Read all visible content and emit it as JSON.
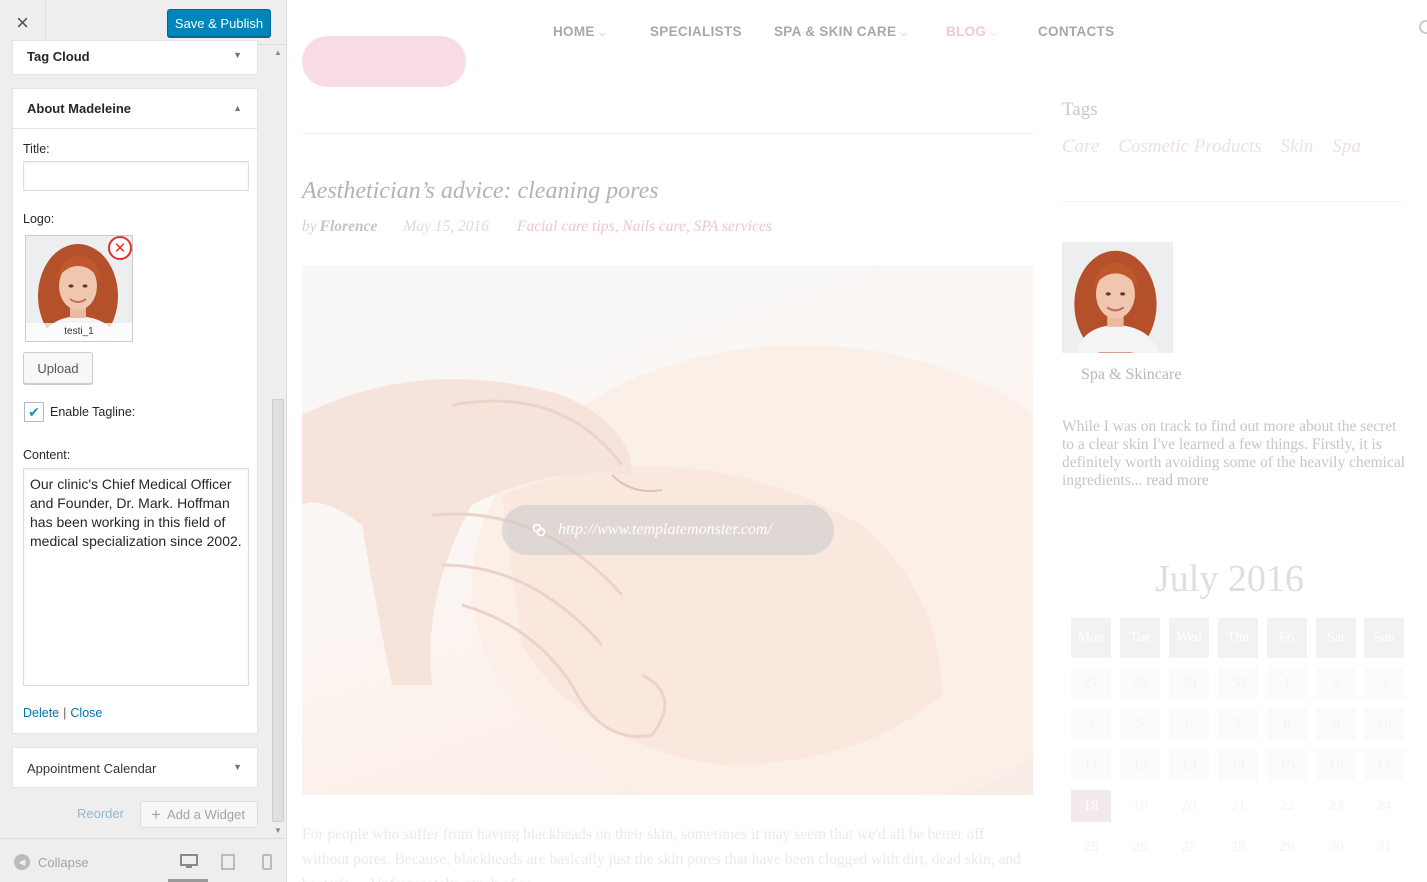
{
  "sidebar": {
    "close_label": "×",
    "publish_label": "Save & Publish",
    "tag_cloud_title": "Tag Cloud",
    "about_title": "About Madeleine",
    "title_label": "Title:",
    "title_value": "",
    "logo_label": "Logo:",
    "logo_caption": "testi_1",
    "upload_label": "Upload",
    "tagline_checked": true,
    "tagline_label": "Enable Tagline:",
    "content_label": "Content:",
    "content_value": "Our clinic's Chief Medical Officer and Founder, Dr. Mark. Hoffman has been working in this field of medical specialization since 2002.",
    "delete_label": "Delete",
    "close_link_label": "Close",
    "appointment_title": "Appointment Calendar",
    "reorder_label": "Reorder",
    "add_widget_label": "Add a Widget",
    "collapse_label": "Collapse",
    "icons": [
      "close-icon",
      "chevron-down-icon",
      "chevron-up-icon",
      "remove-icon",
      "checkmark-icon",
      "plus-icon",
      "collapse-arrow-icon",
      "desktop-icon",
      "tablet-icon",
      "mobile-icon"
    ]
  },
  "preview": {
    "nav": {
      "home": "HOME",
      "specialists": "SPECIALISTS",
      "spa": "SPA & SKIN CARE",
      "blog": "BLOG",
      "contacts": "CONTACTS"
    },
    "post": {
      "title": "Aesthetician’s advice: cleaning pores",
      "by": "by",
      "author": "Florence",
      "date": "May 15, 2016",
      "categories": "Facial care tips, Nails care, SPA services",
      "link_url": "http://www.templatemonster.com/",
      "excerpt": "For people who suffer from having blackheads on their skin, sometimes it may seem that we'd all be better off without pores. Because, blackheads are basically just the skin pores that have been clogged with dirt, dead skin, and bacteria… Unfortunately, much of so"
    },
    "tags": {
      "title": "Tags",
      "items": [
        "Care",
        "Cosmetic Products",
        "Skin",
        "Spa"
      ]
    },
    "about": {
      "tagline": "Spa & Skincare",
      "text": "While I was on track to find out more about the secret to a clear skin I've learned a few things. Firstly, it is definitely worth avoiding some of the heavily chemical ingredients...",
      "read_more": "read more"
    },
    "calendar": {
      "title": "July 2016",
      "weekdays": [
        "Mon",
        "Tue",
        "Wed",
        "Thu",
        "Fri",
        "Sat",
        "Sun"
      ],
      "weeks": [
        [
          "27",
          "28",
          "29",
          "30",
          "1",
          "2",
          "3"
        ],
        [
          "4",
          "5",
          "6",
          "7",
          "8",
          "9",
          "10"
        ],
        [
          "11",
          "12",
          "13",
          "14",
          "15",
          "16",
          "17"
        ],
        [
          "18",
          "19",
          "20",
          "21",
          "22",
          "23",
          "24"
        ],
        [
          "25",
          "26",
          "27",
          "28",
          "29",
          "30",
          "31"
        ]
      ],
      "today": "18"
    }
  },
  "colors": {
    "publish": "#0085ba",
    "link": "#0073aa",
    "remove": "#dc3232",
    "accent_pink": "#f2c4ce"
  }
}
